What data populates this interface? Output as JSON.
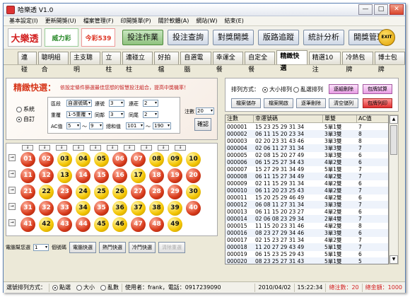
{
  "window": {
    "title": "哈樂透 V1.0",
    "min": "—",
    "max": "□",
    "close": "✕"
  },
  "menu": [
    "基本設定(I)",
    "更新開獎(U)",
    "檔案管理(F)",
    "印開獎單(P)",
    "關於軟體(A)",
    "網站(W)",
    "結束(E)"
  ],
  "toolbar": {
    "logos": [
      "大樂透",
      "威力彩",
      "今彩539"
    ],
    "buttons": [
      "投注作業",
      "投注查詢",
      "對獎開獎",
      "版路追蹤",
      "統計分析",
      "開獎管理"
    ],
    "active": "投注作業",
    "exit": "EXIT"
  },
  "tabs": [
    "連碰",
    "聰明組合",
    "主支聰明",
    "立柱",
    "連碰立柱",
    "好拍檔",
    "自選電腦",
    "幸運全餐",
    "自定全餐",
    "精緻快選",
    "精選10注",
    "冷熱包牌",
    "博士包牌"
  ],
  "active_tab": "精緻快選",
  "quickpick": {
    "title": "精緻快選：",
    "hint": "依設定條件篩選最佳您想的智慧投注組合，提高中獎機率！",
    "radio_system": "系統",
    "radio_custom": "自訂",
    "field_row1": [
      "區段",
      "自選號碼",
      "連號",
      "3",
      "連莊",
      "2"
    ],
    "field_row2": [
      "重覆",
      "1-5重覆",
      "同鄰",
      "3",
      "同尾",
      "2"
    ],
    "field_row3": [
      "AC值",
      "5",
      "9",
      "總和值",
      "101",
      "190"
    ],
    "to_sym": "～",
    "bet_label": "注數",
    "bet_value": "20",
    "confirm": "確認"
  },
  "balls": [
    "01",
    "02",
    "03",
    "04",
    "05",
    "06",
    "07",
    "08",
    "09",
    "10",
    "11",
    "12",
    "13",
    "14",
    "15",
    "16",
    "17",
    "18",
    "19",
    "20",
    "21",
    "22",
    "23",
    "24",
    "25",
    "26",
    "27",
    "28",
    "29",
    "30",
    "31",
    "32",
    "33",
    "34",
    "35",
    "36",
    "37",
    "38",
    "39",
    "40",
    "41",
    "42",
    "43",
    "44",
    "45",
    "46",
    "47",
    "48",
    "49"
  ],
  "red_balls": [
    "01",
    "02",
    "06",
    "07",
    "11",
    "12",
    "14",
    "15",
    "16",
    "18",
    "19",
    "20",
    "21",
    "23",
    "27",
    "28",
    "29",
    "31",
    "32",
    "33",
    "35",
    "40",
    "41",
    "43",
    "44",
    "47",
    "48"
  ],
  "ball_controls": {
    "pick_label": "電腦幫您選",
    "pick_count": "1",
    "count_suffix": "個號碼",
    "buttons": [
      "電腦快選",
      "熱門快選",
      "冷門快選",
      "清除重選"
    ]
  },
  "sort_panel": {
    "label": "排列方式：",
    "opt_size": "大小排列",
    "opt_random": "亂選排列",
    "buttons": [
      "逐組刪除",
      "包牌試算",
      "檔案儲存",
      "檔案開啟",
      "逐筆刪除",
      "清空儲列",
      "包牌列印"
    ]
  },
  "table": {
    "headers": [
      "注數",
      "幸運號碼",
      "單雙",
      "AC值"
    ],
    "rows": [
      [
        "000001",
        "15 23 25 29 31 34",
        "5單1雙",
        "7"
      ],
      [
        "000002",
        "06 11 15 20 23 34",
        "3單3雙",
        "8"
      ],
      [
        "000003",
        "02 20 23 31 43 46",
        "3單3雙",
        "8"
      ],
      [
        "000004",
        "02 06 11 27 31 34",
        "3單3雙",
        "7"
      ],
      [
        "000005",
        "02 08 15 20 27 49",
        "3單3雙",
        "6"
      ],
      [
        "000006",
        "06 15 25 27 34 43",
        "4單2雙",
        "6"
      ],
      [
        "000007",
        "15 27 29 31 34 49",
        "5單1雙",
        "7"
      ],
      [
        "000008",
        "06 11 15 27 34 49",
        "4單2雙",
        "7"
      ],
      [
        "000009",
        "02 11 15 29 31 34",
        "4單2雙",
        "6"
      ],
      [
        "000010",
        "06 11 20 23 25 43",
        "4單2雙",
        "7"
      ],
      [
        "000011",
        "15 20 25 29 46 49",
        "4單2雙",
        "6"
      ],
      [
        "000012",
        "06 08 11 27 31 34",
        "3單3雙",
        "7"
      ],
      [
        "000013",
        "06 11 15 20 23 27",
        "4單2雙",
        "6"
      ],
      [
        "000014",
        "02 06 08 23 29 34",
        "2單4雙",
        "7"
      ],
      [
        "000015",
        "11 15 20 23 31 46",
        "4單2雙",
        "8"
      ],
      [
        "000016",
        "08 23 27 29 34 46",
        "3單3雙",
        "6"
      ],
      [
        "000017",
        "02 15 23 27 31 34",
        "4單2雙",
        "7"
      ],
      [
        "000018",
        "11 20 27 29 43 49",
        "5單1雙",
        "7"
      ],
      [
        "000019",
        "06 15 23 25 29 43",
        "5單1雙",
        "6"
      ],
      [
        "000020",
        "08 23 25 27 31 43",
        "5單1雙",
        "5"
      ]
    ]
  },
  "status": {
    "sort_label": "選號排列方式：",
    "opt_order": "點選",
    "opt_size": "大小",
    "opt_random": "亂數",
    "user": "使用者：frank，電話：0917239090",
    "date": "2010/04/02",
    "time": "15:22:34",
    "total_label": "總注數：20",
    "amount_label": "總金額：1000"
  },
  "colors": {
    "ball_yellow": "#f3c400",
    "ball_red": "#d83a1a",
    "title_red": "#d7371b",
    "active_tab_green": "#8fc27f"
  }
}
